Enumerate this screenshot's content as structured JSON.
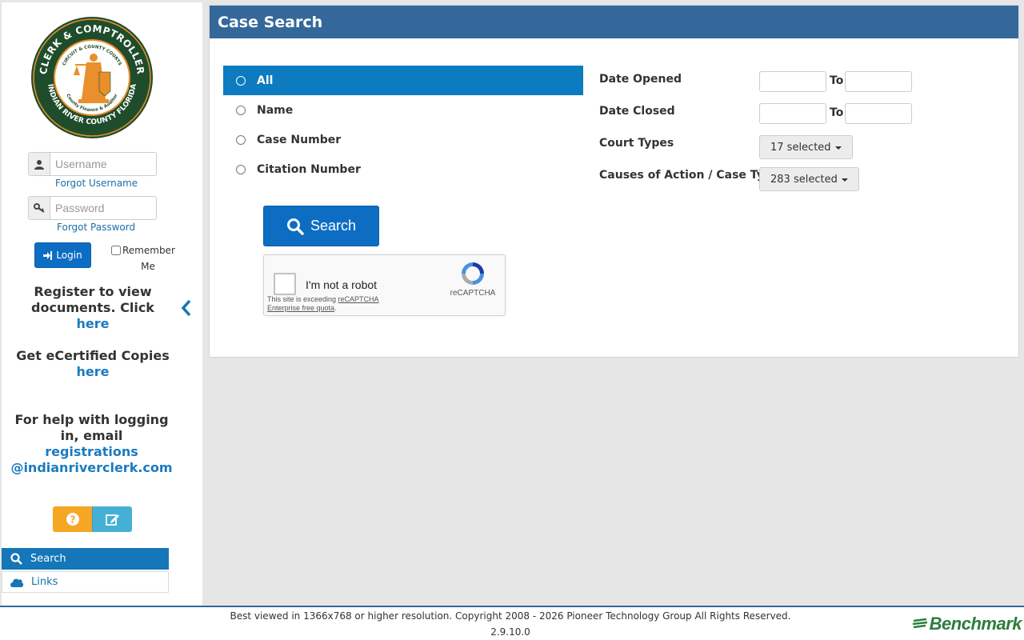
{
  "sidebar": {
    "logo": {
      "top_text": "CLERK & COMPTROLLER",
      "inner_top": "CIRCUIT & COUNTY COURTS",
      "inner_bottom": "County Finance & Auditor",
      "bottom_text": "INDIAN RIVER COUNTY FLORIDA"
    },
    "username_placeholder": "Username",
    "forgot_username": "Forgot Username",
    "password_placeholder": "Password",
    "forgot_password": "Forgot Password",
    "login_label": "Login",
    "remember_label": "Remember Me",
    "register_text": "Register to view documents. Click ",
    "register_link": "here",
    "ecert_text": "Get eCertified Copies",
    "ecert_link": "here",
    "help_text": "For help with logging in, email",
    "help_email_1": "registrations",
    "help_email_2": "@indianriverclerk.com",
    "nav": [
      {
        "label": "Search"
      },
      {
        "label": "Links"
      }
    ]
  },
  "panel": {
    "title": "Case Search",
    "search_options": [
      {
        "label": "All",
        "selected": true
      },
      {
        "label": "Name",
        "selected": false
      },
      {
        "label": "Case Number",
        "selected": false
      },
      {
        "label": "Citation Number",
        "selected": false
      }
    ],
    "search_button": "Search",
    "captcha": {
      "label": "I'm not a robot",
      "note_prefix": "This site is exceeding ",
      "note_link": "reCAPTCHA Enterprise free quota",
      "note_suffix": ".",
      "brand": "reCAPTCHA"
    },
    "date_opened_label": "Date Opened",
    "date_closed_label": "Date Closed",
    "to_label": "To",
    "court_types_label": "Court Types",
    "court_types_value": "17 selected",
    "causes_label": "Causes of Action / Case Types",
    "causes_value": "283 selected"
  },
  "footer": {
    "copyright": "Best viewed in 1366x768 or higher resolution. Copyright 2008 - 2026 Pioneer Technology Group All Rights Reserved.",
    "version": "2.9.10.0",
    "brand": "Benchmark"
  },
  "colors": {
    "header_blue": "#34689a",
    "primary_button": "#0c6dc3",
    "selected_row": "#0c7bc0",
    "link": "#1a7bbf",
    "help_button": "#f5a623",
    "edit_button": "#45b0d5",
    "benchmark_green": "#2c7c3e"
  }
}
